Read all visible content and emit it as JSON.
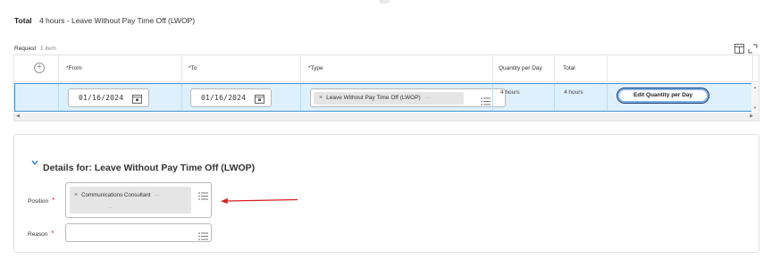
{
  "summary": {
    "label": "Total",
    "value": "4 hours - Leave Without Pay Time Off (LWOP)"
  },
  "request": {
    "label": "Request",
    "count": "1 item",
    "columns": {
      "from": "*From",
      "to": "*To",
      "type": "*Type",
      "qty": "Quantity per Day",
      "total": "Total"
    },
    "row": {
      "from": "01/16/2024",
      "to": "01/16/2024",
      "type": "Leave Without Pay Time Off (LWOP)",
      "qty": "4 hours",
      "total": "4 hours",
      "edit_button": "Edit Quantity per Day"
    }
  },
  "details": {
    "title": "Details for: Leave Without Pay Time Off (LWOP)",
    "position_label": "Position",
    "position_value": "Communications Consultant",
    "position_subtext": ".",
    "reason_label": "Reason",
    "required_mark": "*",
    "remove_glyph": "×",
    "more_glyph": "···"
  },
  "colors": {
    "selected_row_bg": "#ddf0fb",
    "selected_row_border": "#3e91d1",
    "required": "#d03030",
    "chevron": "#1c6fd1",
    "annotation_arrow": "#d42020"
  },
  "icons": {
    "add": "plus-circle-icon",
    "calendar": "calendar-icon",
    "list": "list-prompt-icon",
    "table_view": "table-icon",
    "expand": "expand-icon",
    "collapse": "chevron-down-icon"
  }
}
